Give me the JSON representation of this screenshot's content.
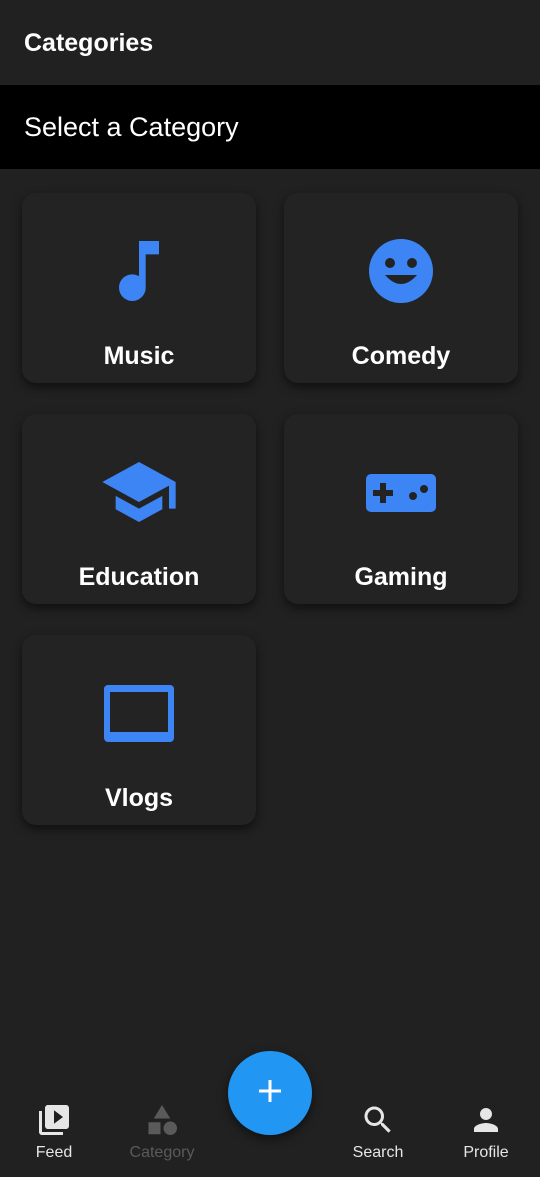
{
  "appbar": {
    "title": "Categories"
  },
  "subheader": {
    "text": "Select a Category"
  },
  "categories": [
    {
      "label": "Music",
      "icon": "music-note-icon"
    },
    {
      "label": "Comedy",
      "icon": "smiley-face-icon"
    },
    {
      "label": "Education",
      "icon": "graduation-cap-icon"
    },
    {
      "label": "Gaming",
      "icon": "gamepad-icon"
    },
    {
      "label": "Vlogs",
      "icon": "tv-screen-icon"
    }
  ],
  "fab": {
    "icon": "plus-icon"
  },
  "bottom_nav": {
    "items": [
      {
        "label": "Feed",
        "icon": "video-library-icon",
        "active": false
      },
      {
        "label": "Category",
        "icon": "shapes-icon",
        "active": true
      },
      {
        "label": "Search",
        "icon": "search-icon",
        "active": false
      },
      {
        "label": "Profile",
        "icon": "person-icon",
        "active": false
      }
    ]
  },
  "colors": {
    "background": "#212121",
    "card": "#232323",
    "subheader": "#000000",
    "accent": "#3D85F5",
    "fab": "#2196F3",
    "nav_active": "#5A5A5A",
    "nav_inactive": "#E6E6E6"
  }
}
